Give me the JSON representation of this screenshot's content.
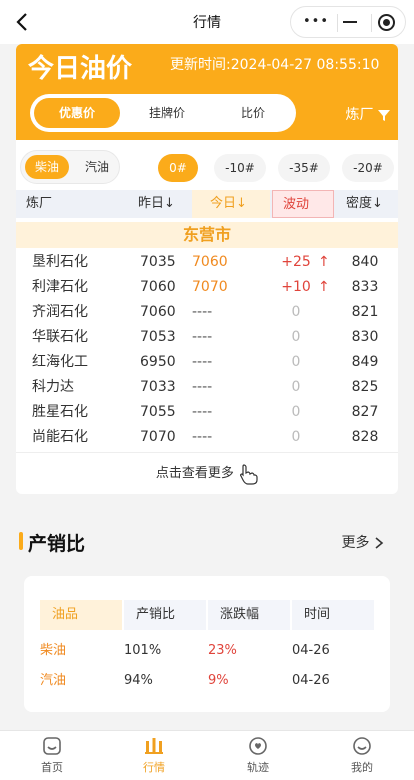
{
  "topbar": {
    "title": "行情",
    "back_icon": "chevron-left-icon"
  },
  "price_card": {
    "title": "今日油价",
    "update_time": "更新时间:2024-04-27 08:55:10",
    "segments": [
      "优惠价",
      "挂牌价",
      "比价"
    ],
    "active_segment": "优惠价",
    "refinery_filter_label": "炼厂",
    "fuel_types": [
      "柴油",
      "汽油"
    ],
    "active_fuel": "柴油",
    "grades": [
      "0#",
      "-10#",
      "-35#",
      "-20#"
    ],
    "active_grade": "0#",
    "columns": [
      "炼厂",
      "昨日↓",
      "今日↓",
      "波动",
      "密度↓"
    ],
    "city": "东营市",
    "rows": [
      {
        "name": "垦利石化",
        "yesterday": "7035",
        "today": "7060",
        "change": "+25",
        "density": "840"
      },
      {
        "name": "利津石化",
        "yesterday": "7060",
        "today": "7070",
        "change": "+10",
        "density": "833"
      },
      {
        "name": "齐润石化",
        "yesterday": "7060",
        "today": "----",
        "change": "0",
        "density": "821"
      },
      {
        "name": "华联石化",
        "yesterday": "7053",
        "today": "----",
        "change": "0",
        "density": "830"
      },
      {
        "name": "红海化工",
        "yesterday": "6950",
        "today": "----",
        "change": "0",
        "density": "849"
      },
      {
        "name": "科力达",
        "yesterday": "7033",
        "today": "----",
        "change": "0",
        "density": "825"
      },
      {
        "name": "胜星石化",
        "yesterday": "7055",
        "today": "----",
        "change": "0",
        "density": "827"
      },
      {
        "name": "尚能石化",
        "yesterday": "7070",
        "today": "----",
        "change": "0",
        "density": "828"
      }
    ],
    "more_label": "点击查看更多"
  },
  "sales_section": {
    "title": "产销比",
    "more_label": "更多",
    "columns": [
      "油品",
      "产销比",
      "涨跌幅",
      "时间"
    ],
    "rows": [
      {
        "product": "柴油",
        "ratio": "101%",
        "change": "23%",
        "date": "04-26"
      },
      {
        "product": "汽油",
        "ratio": "94%",
        "change": "9%",
        "date": "04-26"
      }
    ]
  },
  "tabbar": {
    "items": [
      {
        "label": "首页",
        "icon": "home-icon"
      },
      {
        "label": "行情",
        "icon": "market-icon"
      },
      {
        "label": "轨迹",
        "icon": "track-icon"
      },
      {
        "label": "我的",
        "icon": "profile-icon"
      }
    ],
    "active": "行情"
  },
  "colors": {
    "accent": "#fbab1a",
    "up": "#e0443b",
    "today": "#f08a20"
  }
}
